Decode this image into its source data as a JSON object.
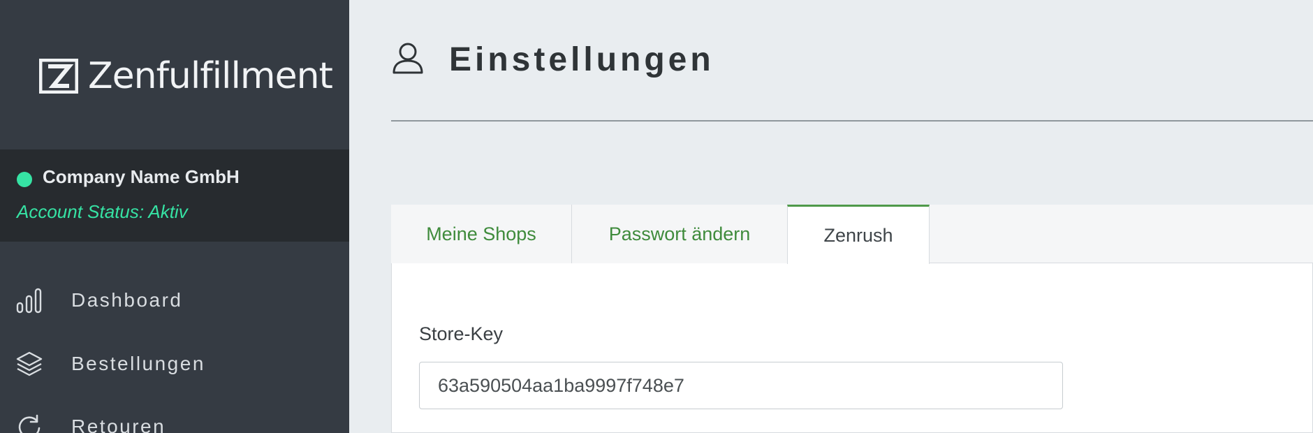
{
  "sidebar": {
    "brand": {
      "logo_text": "Zenfulfillment",
      "logo_icon": "z-logo-icon"
    },
    "account": {
      "company": "Company Name GmbH",
      "status": "Account Status: Aktiv",
      "status_color": "#36e3a4"
    },
    "nav": [
      {
        "label": "Dashboard",
        "icon": "bar-chart-icon"
      },
      {
        "label": "Bestellungen",
        "icon": "layers-icon"
      },
      {
        "label": "Retouren",
        "icon": "refresh-icon"
      }
    ]
  },
  "page": {
    "title": "Einstellungen",
    "title_icon": "user-icon"
  },
  "tabs": [
    {
      "label": "Meine Shops",
      "active": false
    },
    {
      "label": "Passwort ändern",
      "active": false
    },
    {
      "label": "Zenrush",
      "active": true
    }
  ],
  "form": {
    "store_key_label": "Store-Key",
    "store_key_value": "63a590504aa1ba9997f748e7"
  },
  "colors": {
    "sidebar": "#353b43",
    "account_panel": "#272b2f",
    "accent_green": "#3f8b3c",
    "active_tab_border": "#4f9a4a"
  }
}
